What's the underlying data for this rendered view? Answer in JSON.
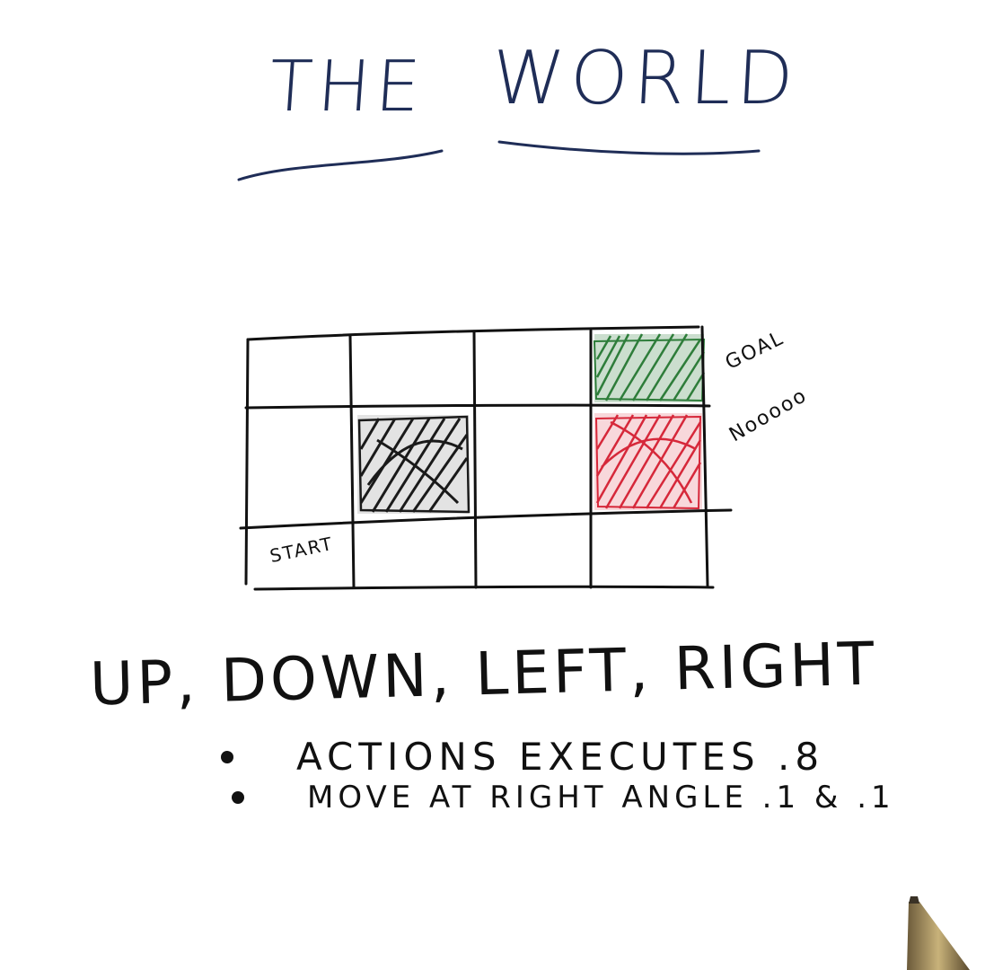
{
  "title": {
    "word1": "THE",
    "word2": "WORLD"
  },
  "grid": {
    "rows": 3,
    "cols": 4,
    "cells": {
      "start_label": "START",
      "goal_label": "GOAL",
      "pit_label": "Nooooo"
    },
    "colors": {
      "goal": "#2e7d3a",
      "pit": "#d6283a",
      "wall": "#1a1a1a",
      "ink": "#111111",
      "title_ink": "#1f2d57"
    }
  },
  "actions": {
    "heading": "UP, DOWN, LEFT, RIGHT",
    "bullets": [
      {
        "text": "ACTIONS EXECUTES .8"
      },
      {
        "text": "MOVE AT RIGHT ANGLE .1 & .1"
      }
    ]
  }
}
